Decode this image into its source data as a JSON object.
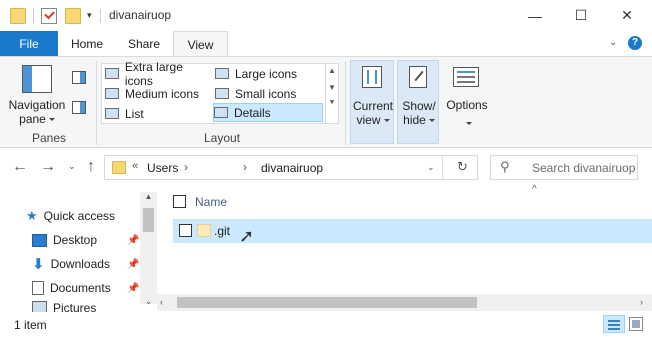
{
  "window": {
    "title": "divanairuop",
    "minimize": "—",
    "maximize": "☐",
    "close": "✕"
  },
  "ribbon_tabs": [
    "File",
    "Home",
    "Share",
    "View"
  ],
  "ribbon": {
    "panes": {
      "navigation_pane_line1": "Navigation",
      "navigation_pane_line2": "pane",
      "group_label": "Panes"
    },
    "layout": {
      "items": [
        "Extra large icons",
        "Large icons",
        "Medium icons",
        "Small icons",
        "List",
        "Details"
      ],
      "selected": "Details",
      "group_label": "Layout"
    },
    "current_view_line1": "Current",
    "current_view_line2": "view",
    "show_hide_line1": "Show/",
    "show_hide_line2": "hide",
    "options": "Options"
  },
  "address": {
    "overflow": "«",
    "crumbs": [
      "Users",
      "divanairuop"
    ],
    "search_placeholder": "Search divanairuop"
  },
  "nav_pane": {
    "items": [
      {
        "label": "Quick access",
        "icon": "star-icon"
      },
      {
        "label": "Desktop",
        "icon": "desktop-icon",
        "pinned": true
      },
      {
        "label": "Downloads",
        "icon": "download-icon",
        "pinned": true
      },
      {
        "label": "Documents",
        "icon": "document-icon",
        "pinned": true
      },
      {
        "label": "Pictures",
        "icon": "pictures-icon",
        "pinned": true
      }
    ]
  },
  "content": {
    "column_name": "Name",
    "files": [
      {
        "name": ".git",
        "type": "folder"
      }
    ]
  },
  "status": {
    "item_count": "1 item"
  },
  "colors": {
    "accent": "#1979ca",
    "selection": "#cce8ff",
    "folder": "#f8d775"
  }
}
